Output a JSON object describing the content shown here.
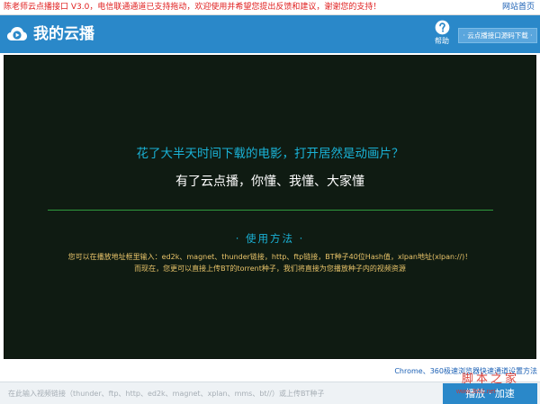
{
  "notice": {
    "text": "陈老师云点播接口 V3.0，电信联通通道已支持拖动，欢迎使用并希望您提出反馈和建议，谢谢您的支持！",
    "link": "网站首页"
  },
  "header": {
    "title": "我的云播",
    "help_label": "帮助",
    "source_button": "· 云点播接口源码下载 ·",
    "logo_icon": "cloud-play-icon",
    "help_icon": "question-circle-icon"
  },
  "stage": {
    "headline": "花了大半天时间下载的电影，打开居然是动画片？",
    "subline": "有了云点播，你懂、我懂、大家懂",
    "usage_title": "· 使用方法 ·",
    "usage_line1": "您可以在播放地址框里输入：ed2k、magnet、thunder链接，http、ftp链接，BT种子40位Hash值，xlpan地址(xlpan://)！",
    "usage_line2": "而现在，您更可以直接上传BT的torrent种子，我们将直接为您播放种子内的视频资源"
  },
  "footer": {
    "browser_tip": "Chrome、360极速浏览器快速通道设置方法",
    "input_placeholder": "在此输入视频链接（thunder、ftp、http、ed2k、magnet、xplan、mms、bt//）或上传BT种子",
    "input_value": "",
    "play_button": "播放 · 加速"
  },
  "watermark": {
    "text": "脚本之家",
    "url": "www.Jb51.net"
  },
  "colors": {
    "brand_blue": "#2a88c9",
    "stage_bg": "#0f1b12",
    "headline_cyan": "#1ab2d6",
    "usage_gold": "#e9c46a",
    "divider_green": "#2f9a3d",
    "notice_red": "#e02020"
  }
}
